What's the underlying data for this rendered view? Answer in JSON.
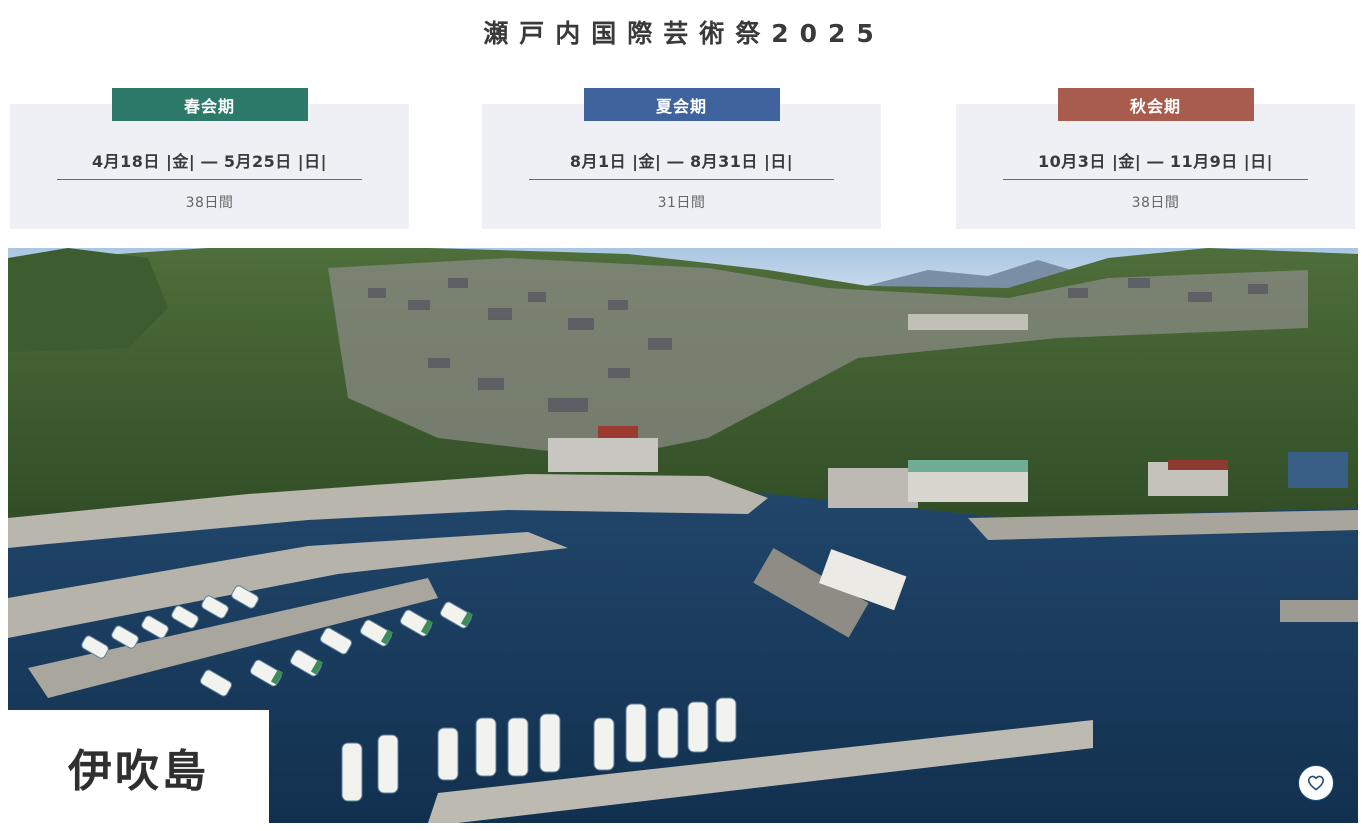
{
  "header": {
    "title": "瀬戸内国際芸術祭2025"
  },
  "seasons": [
    {
      "label": "春会期",
      "dates": "4月18日 |金| ― 5月25日 |日|",
      "days": "38日間",
      "color": "#2e7a6a"
    },
    {
      "label": "夏会期",
      "dates": "8月1日 |金| ― 8月31日 |日|",
      "days": "31日間",
      "color": "#3f639d"
    },
    {
      "label": "秋会期",
      "dates": "10月3日 |金| ― 11月9日 |日|",
      "days": "38日間",
      "color": "#a85c4d"
    }
  ],
  "hero": {
    "island_name": "伊吹島",
    "favorite_icon": "heart-icon"
  },
  "colors": {
    "accent_blue": "#1f4f7a",
    "card_bg": "#eef0f5"
  }
}
